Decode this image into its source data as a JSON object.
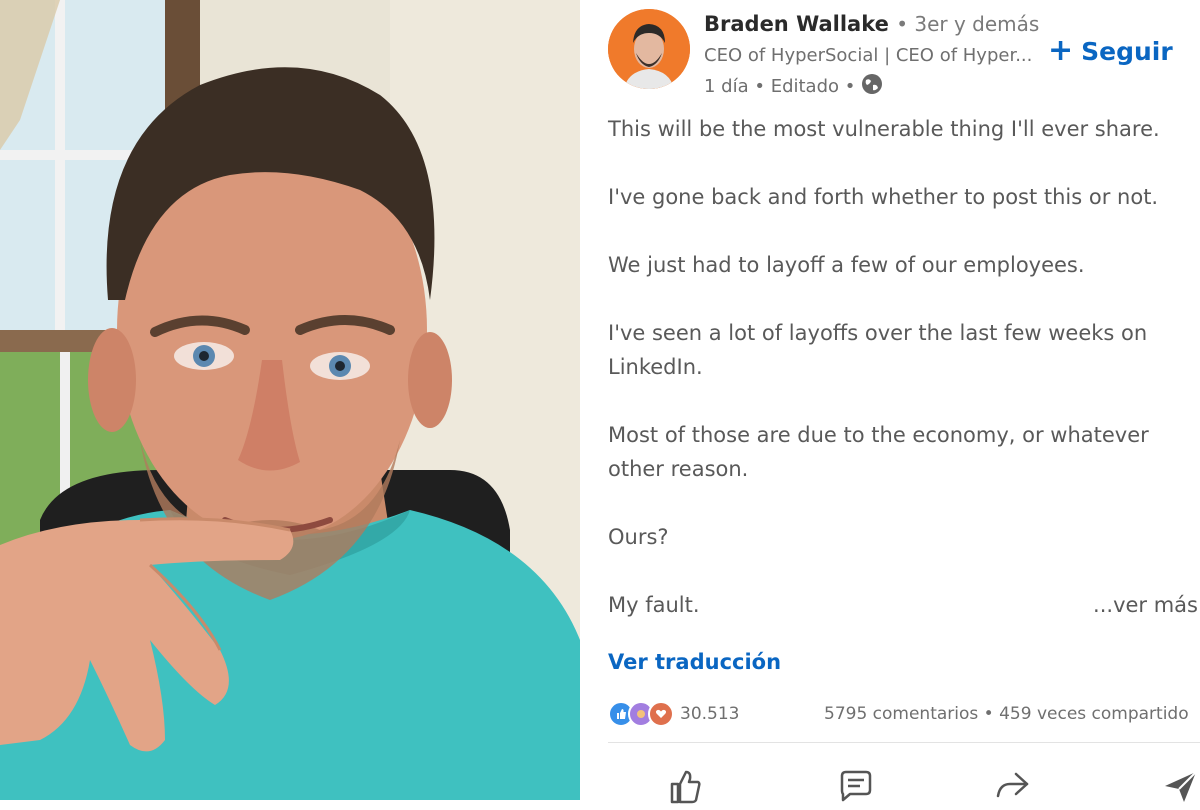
{
  "post": {
    "author": {
      "name": "Braden Wallake",
      "degree": "• 3er y demás",
      "headline": "CEO of HyperSocial | CEO of Hyper...",
      "time": "1 día • Editado •"
    },
    "follow_label": "Seguir",
    "paragraphs": [
      "This will be the most vulnerable thing I'll ever share.",
      "I've gone back and forth whether to post this or not.",
      "We just had to layoff a few of our employees.",
      "I've seen a lot of layoffs over the last few weeks on LinkedIn.",
      "Most of those are due to the economy, or whatever other reason.",
      "Ours?"
    ],
    "last_paragraph": "My fault.",
    "see_more": "...ver más",
    "translate_label": "Ver traducción",
    "reaction_count": "30.513",
    "social_counts": "5795 comentarios • 459 veces compartido"
  },
  "icons": {
    "globe": "globe-icon",
    "like": "like-icon",
    "comment": "comment-icon",
    "share": "share-icon",
    "send": "send-icon"
  },
  "colors": {
    "accent": "#0a66c2",
    "avatar_bg": "#f07a2b",
    "shirt": "#3fc1c0"
  }
}
